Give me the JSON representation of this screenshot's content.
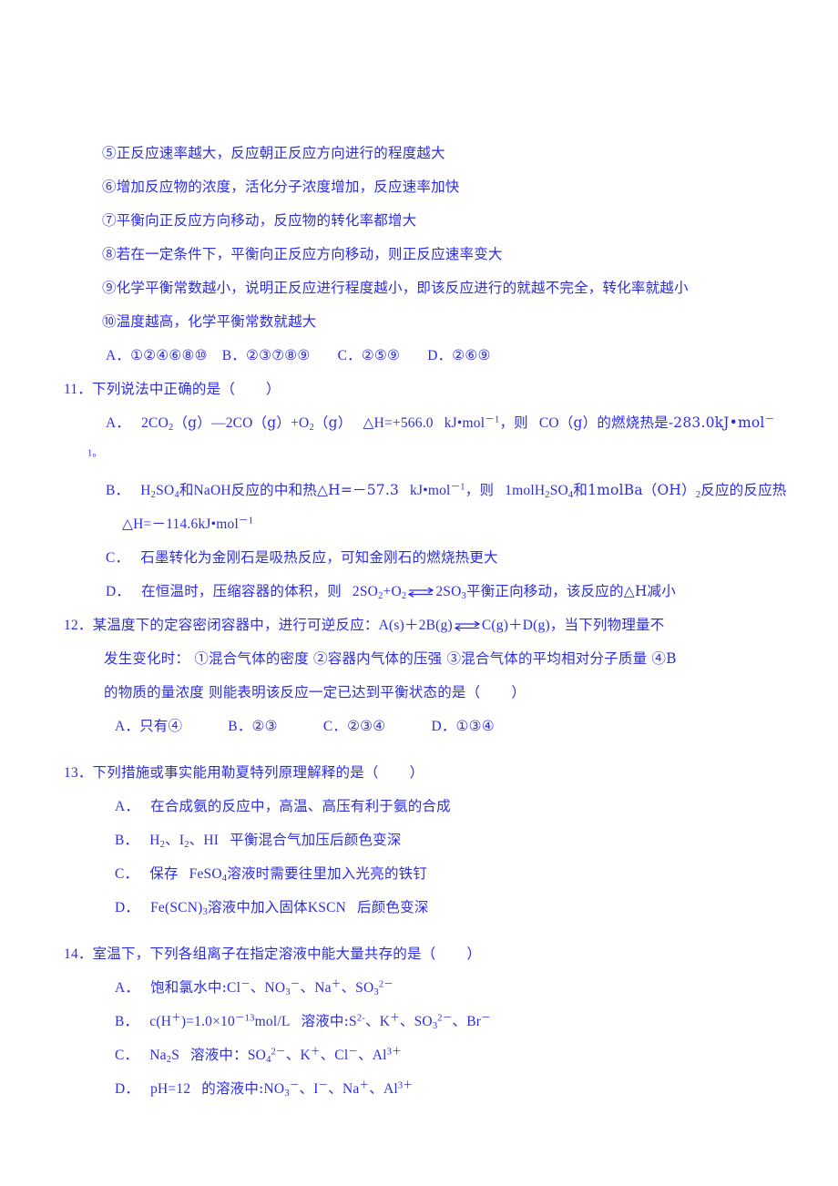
{
  "document": {
    "type": "chinese-chemistry-exam",
    "text_color": "#2d2de0",
    "background_color": "#ffffff"
  },
  "question_10_tail": {
    "statements": [
      "⑤正反应速率越大，反应朝正反应方向进行的程度越大",
      "⑥增加反应物的浓度，活化分子浓度增加，反应速率加快",
      "⑦平衡向正反应方向移动，反应物的转化率都增大",
      "⑧若在一定条件下，平衡向正反应方向移动，则正反应速率变大",
      "⑨化学平衡常数越小，说明正反应进行程度越小，即该反应进行的就越不完全，转化率就越小",
      "⑩温度越高，化学平衡常数就越大"
    ],
    "options": [
      {
        "label": "A．",
        "text": "①②④⑥⑧⑩"
      },
      {
        "label": "B．",
        "text": "②③⑦⑧⑨"
      },
      {
        "label": "C．",
        "text": "②⑤⑨"
      },
      {
        "label": "D．",
        "text": "②⑥⑨"
      }
    ]
  },
  "question_11": {
    "number": "11．",
    "stem": "下列说法中正确的是（",
    "stem_close": "）",
    "option_a": {
      "label": "A．",
      "formula_lhs": "2CO",
      "sub_1": "2",
      "g_1": "（g）",
      "dash": "—",
      "mid": "2CO",
      "g_2": "（g）",
      "plus_o": "+O",
      "sub_2": "2",
      "g_3": "（g）",
      "delta": "△H=+566.0",
      "unit": "kJ•mol",
      "unit_sup": "－1",
      "comma": "，则",
      "co": "CO",
      "g_4": "（g）",
      "tail": "的燃烧热是-283.0kJ•mol",
      "tail_sup": "－",
      "wrap_line": "1。"
    },
    "option_b": {
      "label": "B．",
      "h2so4": "H",
      "h2so4_sub1": "2",
      "h2so4_mid": "SO",
      "h2so4_sub2": "4",
      "and_1": "和",
      "naoh": "NaOH",
      "text_1": "反应的中和热△H=－57.3",
      "unit_1": "kJ•mol",
      "unit_1_sup": "－1",
      "text_2": "，则",
      "mol1": "1molH",
      "mol1_sub": "2",
      "mol1_mid": "SO",
      "mol1_sub2": "4",
      "and_2": "和",
      "mol2": "1molBa（OH）",
      "mol2_sub": "2",
      "text_3": "反应的反应热",
      "line2": "△H=－114.6kJ•mol",
      "line2_sup": "－1"
    },
    "option_c": {
      "label": "C．",
      "text": "石墨转化为金刚石是吸热反应，可知金刚石的燃烧热更大"
    },
    "option_d": {
      "label": "D．",
      "text_1": "在恒温时，压缩容器的体积，则",
      "f1": "2SO",
      "f1_sub": "2",
      "f1_plus": "+O",
      "f1_sub2": "2",
      "f2": "2SO",
      "f2_sub": "3",
      "text_2": "平衡正向移动，该反应的△H减小"
    }
  },
  "question_12": {
    "number": "12．",
    "stem_1": "某温度下的定容密闭容器中，进行可逆反应：",
    "f_a": "A(s)＋2B(g)",
    "f_b": "C(g)＋D(g)",
    "stem_2": "，当下列物理量不",
    "line_2": "发生变化时：  ①混合气体的密度 ②容器内气体的压强 ③混合气体的平均相对分子质量 ④B",
    "line_3": "的物质的量浓度  则能表明该反应一定已达到平衡状态的是（",
    "line_3_close": "）",
    "options": [
      {
        "label": "A．",
        "text": "只有④"
      },
      {
        "label": "B．",
        "text": "②③"
      },
      {
        "label": "C．",
        "text": "②③④"
      },
      {
        "label": "D．",
        "text": "①③④"
      }
    ]
  },
  "question_13": {
    "number": "13．",
    "stem": "下列措施或事实能用勒夏特列原理解释的是（",
    "stem_close": "）",
    "option_a": {
      "label": "A．",
      "text": "在合成氨的反应中，高温、高压有利于氨的合成"
    },
    "option_b": {
      "label": "B．",
      "h2": "H",
      "h2_sub": "2",
      "sep1": "、",
      "i2": "I",
      "i2_sub": "2",
      "sep2": "、",
      "hi": "HI",
      "text": "平衡混合气加压后颜色变深"
    },
    "option_c": {
      "label": "C．",
      "text_1": "保存",
      "feso4": "FeSO",
      "feso4_sub": "4",
      "text_2": "溶液时需要往里加入光亮的铁钉"
    },
    "option_d": {
      "label": "D．",
      "fescn": "Fe(SCN)",
      "fescn_sub": "3",
      "text_1": "溶液中加入固体",
      "kscn": "KSCN",
      "text_2": "后颜色变深"
    }
  },
  "question_14": {
    "number": "14．",
    "stem": "室温下，下列各组离子在指定溶液中能大量共存的是（",
    "stem_close": "）",
    "option_a": {
      "label": "A．",
      "text_1": "饱和氯水中:",
      "ions": [
        {
          "base": "Cl",
          "sub": "",
          "sup": "－"
        },
        {
          "base": "NO",
          "sub": "3",
          "sup": "－"
        },
        {
          "base": "Na",
          "sub": "",
          "sup": "＋"
        },
        {
          "base": "SO",
          "sub": "3",
          "sup": "2－"
        }
      ]
    },
    "option_b": {
      "label": "B．",
      "prefix": "c(H",
      "prefix_sup": "＋",
      "prefix_2": ")=1.0×10",
      "exp_sup": "－13",
      "prefix_3": "mol/L",
      "text_1": "溶液中:",
      "ions": [
        {
          "base": "S",
          "sub": "",
          "sup": "2-"
        },
        {
          "base": "K",
          "sub": "",
          "sup": "＋"
        },
        {
          "base": "SO",
          "sub": "3",
          "sup": "2－"
        },
        {
          "base": "Br",
          "sub": "",
          "sup": "－"
        }
      ]
    },
    "option_c": {
      "label": "C．",
      "na2s": "Na",
      "na2s_sub": "2",
      "na2s_tail": "S",
      "text_1": "溶液中：",
      "ions": [
        {
          "base": "SO",
          "sub": "4",
          "sup": "2－"
        },
        {
          "base": "K",
          "sub": "",
          "sup": "＋"
        },
        {
          "base": "Cl",
          "sub": "",
          "sup": "－"
        },
        {
          "base": "Al",
          "sub": "",
          "sup": "3＋"
        }
      ]
    },
    "option_d": {
      "label": "D．",
      "prefix": "pH=12",
      "text_1": "的溶液中:",
      "ions": [
        {
          "base": "NO",
          "sub": "3",
          "sup": "－"
        },
        {
          "base": "I",
          "sub": "",
          "sup": "－"
        },
        {
          "base": "Na",
          "sub": "",
          "sup": "＋"
        },
        {
          "base": "Al",
          "sub": "",
          "sup": "3＋"
        }
      ]
    }
  }
}
